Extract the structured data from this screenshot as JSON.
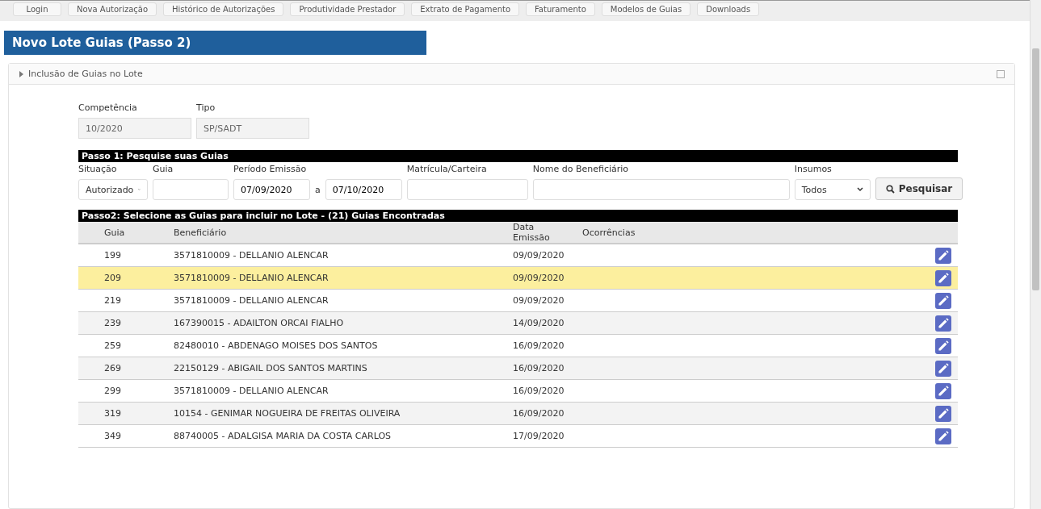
{
  "nav_tabs": [
    "Login",
    "Nova Autorização",
    "Histórico de Autorizações",
    "Produtividade Prestador",
    "Extrato de Pagamento",
    "Faturamento",
    "Modelos de Guias",
    "Downloads"
  ],
  "page_title": "Novo Lote Guias (Passo 2)",
  "panel": {
    "title": "Inclusão de Guias no Lote",
    "expanded": false
  },
  "header_fields": [
    {
      "label": "Competência",
      "value": "10/2020"
    },
    {
      "label": "Tipo",
      "value": "SP/SADT"
    }
  ],
  "step1": {
    "title": "Passo 1: Pesquise suas Guias",
    "situacao": {
      "label": "Situação",
      "value": "Autorizado"
    },
    "guia": {
      "label": "Guia"
    },
    "periodo": {
      "label": "Período Emissão",
      "from": "07/09/2020",
      "separator": "a",
      "to": "07/10/2020"
    },
    "matricula": {
      "label": "Matrícula/Carteira"
    },
    "beneficiario": {
      "label": "Nome do Beneficiário"
    },
    "insumos": {
      "label": "Insumos",
      "value": "Todos"
    },
    "search_button": "Pesquisar"
  },
  "step2": {
    "title": "Passo2: Selecione as Guias para incluir no Lote - (21) Guias Encontradas",
    "columns": [
      "Guia",
      "Beneficiário",
      "Data Emissão",
      "Ocorrências"
    ],
    "rows": [
      {
        "guia": "199",
        "beneficiario": "3571810009 - DELLANIO ALENCAR",
        "data": "09/09/2020",
        "selected": false
      },
      {
        "guia": "209",
        "beneficiario": "3571810009 - DELLANIO ALENCAR",
        "data": "09/09/2020",
        "selected": true
      },
      {
        "guia": "219",
        "beneficiario": "3571810009 - DELLANIO ALENCAR",
        "data": "09/09/2020",
        "selected": false
      },
      {
        "guia": "239",
        "beneficiario": "167390015 - ADAILTON ORCAI FIALHO",
        "data": "14/09/2020",
        "selected": false
      },
      {
        "guia": "259",
        "beneficiario": "82480010 - ABDENAGO MOISES DOS SANTOS",
        "data": "16/09/2020",
        "selected": false
      },
      {
        "guia": "269",
        "beneficiario": "22150129 - ABIGAIL DOS SANTOS MARTINS",
        "data": "16/09/2020",
        "selected": false
      },
      {
        "guia": "299",
        "beneficiario": "3571810009 - DELLANIO ALENCAR",
        "data": "16/09/2020",
        "selected": false
      },
      {
        "guia": "319",
        "beneficiario": "10154 - GENIMAR NOGUEIRA DE FREITAS OLIVEIRA",
        "data": "16/09/2020",
        "selected": false
      },
      {
        "guia": "349",
        "beneficiario": "88740005 - ADALGISA MARIA DA COSTA CARLOS",
        "data": "17/09/2020",
        "selected": false
      }
    ]
  }
}
